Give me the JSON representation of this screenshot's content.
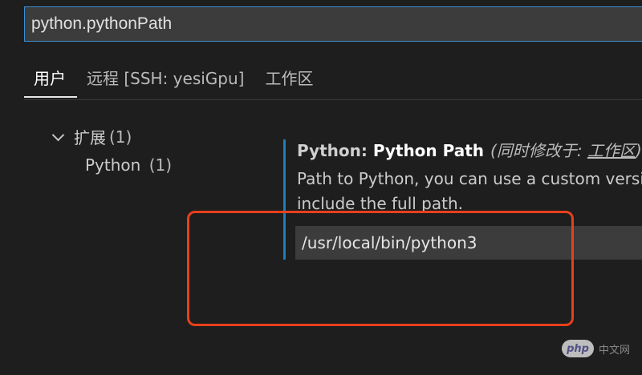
{
  "search": {
    "value": "python.pythonPath"
  },
  "tabs": [
    {
      "label": "用户",
      "active": true
    },
    {
      "label": "远程 [SSH: yesiGpu]",
      "active": false
    },
    {
      "label": "工作区",
      "active": false
    }
  ],
  "tree": {
    "group_label": "扩展",
    "group_count": "(1)",
    "item_label": "Python",
    "item_count": "(1)",
    "chevron_icon": "chevron-down-icon"
  },
  "setting": {
    "category": "Python: ",
    "name": "Python Path",
    "modified_prefix": "(同时修改于: ",
    "modified_link": "工作区",
    "modified_suffix": ")",
    "description_line1": "Path to Python, you can use a custom version of Python by modifying this setting to",
    "description_line2": "include the full path.",
    "value": "/usr/local/bin/python3"
  },
  "watermark": {
    "logo": "php",
    "text": "中文网"
  },
  "colors": {
    "background": "#1e1e1e",
    "accent_blue": "#1f7db8",
    "focus_border": "#3c8fd6",
    "highlight_red": "#e8401c"
  }
}
